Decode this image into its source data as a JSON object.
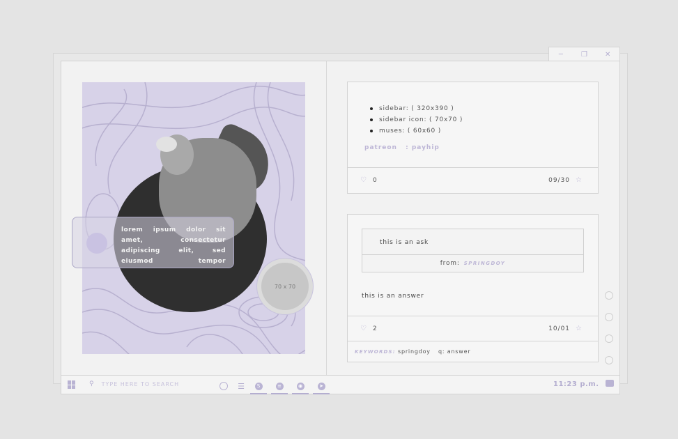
{
  "window": {
    "controls": [
      "minimize",
      "restore",
      "close"
    ]
  },
  "sidebar": {
    "glass_text": "lorem ipsum dolor sit amet, consectetur adipiscing elit, sed eiusmod tempor",
    "icon_placeholder": "70 x 70"
  },
  "post": {
    "list": [
      "sidebar: ( 320x390 )",
      "sidebar icon: ( 70x70 )",
      "muses: ( 60x60 )"
    ],
    "links": [
      "patreon",
      ": payhip"
    ],
    "likes": "0",
    "date": "09/30"
  },
  "ask": {
    "question": "this is an ask",
    "from_label": "from:",
    "from_user": "SPRINGDOY",
    "answer": "this is an answer",
    "likes": "2",
    "date": "10/01",
    "keywords_label": "KEYWORDS:",
    "keywords": [
      "springdoy",
      "q: answer"
    ]
  },
  "taskbar": {
    "search_placeholder": "TYPE HERE TO SEARCH",
    "time": "11:23 p.m.",
    "apps": [
      "cortana-circle",
      "settings-sliders",
      "skype",
      "spotify",
      "chrome",
      "telegram"
    ]
  },
  "colors": {
    "accent": "#b4aed0",
    "bg": "#e4e4e4",
    "panel": "#f2f2f2",
    "sidebar_bg": "#d7d2e8"
  }
}
